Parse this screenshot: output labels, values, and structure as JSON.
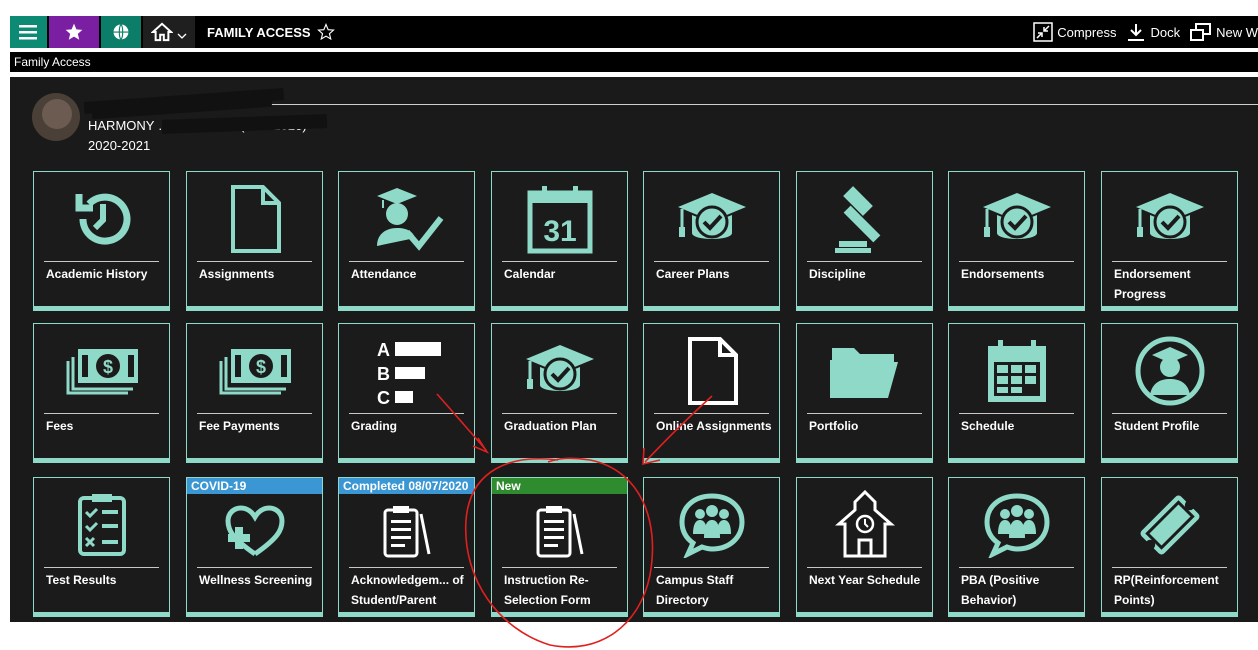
{
  "topbar": {
    "title": "FAMILY ACCESS",
    "actions": [
      "Compress",
      "Dock",
      "New W"
    ]
  },
  "subbar": {
    "label": "Family Access"
  },
  "profile": {
    "school": "HARMONY … - EL PASO (8/17/2020)",
    "year": "2020-2021"
  },
  "colors": {
    "accent": "#8fd9c8",
    "covid": "#3b97d3",
    "completed": "#3b97d3",
    "new": "#2e8b2e"
  },
  "tiles": [
    {
      "label": "Academic History",
      "icon": "history-icon"
    },
    {
      "label": "Assignments",
      "icon": "document-icon"
    },
    {
      "label": "Attendance",
      "icon": "graduate-check-icon"
    },
    {
      "label": "Calendar",
      "icon": "calendar-icon",
      "number": "31"
    },
    {
      "label": "Career Plans",
      "icon": "grad-cap-check-icon"
    },
    {
      "label": "Discipline",
      "icon": "gavel-icon"
    },
    {
      "label": "Endorsements",
      "icon": "grad-cap-check-icon"
    },
    {
      "label": "Endorsement Progress",
      "icon": "grad-cap-check-icon"
    },
    {
      "label": "Fees",
      "icon": "money-icon"
    },
    {
      "label": "Fee Payments",
      "icon": "money-icon"
    },
    {
      "label": "Grading",
      "icon": "grading-icon",
      "grades": [
        "A",
        "B",
        "C"
      ]
    },
    {
      "label": "Graduation Plan",
      "icon": "grad-cap-check-icon"
    },
    {
      "label": "Online Assignments",
      "icon": "document-icon"
    },
    {
      "label": "Portfolio",
      "icon": "folder-icon"
    },
    {
      "label": "Schedule",
      "icon": "schedule-icon"
    },
    {
      "label": "Student Profile",
      "icon": "student-profile-icon"
    },
    {
      "label": "Test Results",
      "icon": "checklist-icon"
    },
    {
      "label": "Wellness Screening",
      "icon": "heart-plus-icon",
      "badge": "COVID-19"
    },
    {
      "label": "Acknowledgem... of Student/Parent",
      "icon": "clipboard-icon",
      "badge": "Completed 08/07/2020"
    },
    {
      "label": "Instruction Re-Selection Form",
      "icon": "clipboard-icon",
      "badge": "New"
    },
    {
      "label": "Campus Staff Directory",
      "icon": "people-bubble-icon"
    },
    {
      "label": "Next Year Schedule",
      "icon": "schoolhouse-icon"
    },
    {
      "label": "PBA (Positive Behavior)",
      "icon": "people-bubble-icon"
    },
    {
      "label": "RP(Reinforcement Points)",
      "icon": "ticket-icon"
    }
  ]
}
